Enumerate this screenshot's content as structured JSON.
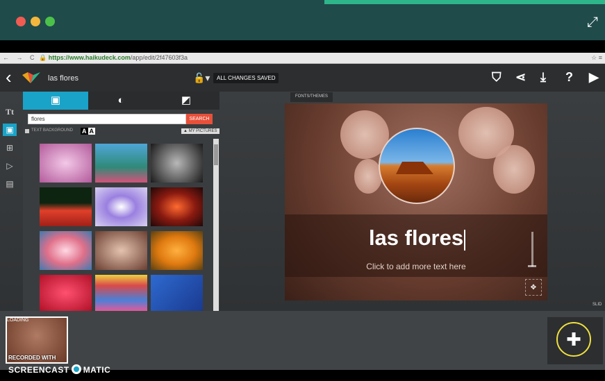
{
  "browser": {
    "url_secure": "https://www.haikudeck.com",
    "url_path": "/app/edit/2f47603f3a",
    "nav_icons": "← → C"
  },
  "app": {
    "deck_name": "las flores",
    "save_status": "ALL CHANGES SAVED",
    "colors": {
      "titlebar": "#1f4b4b",
      "accent": "#1aa3c8",
      "search_button": "#e8503a"
    }
  },
  "image_panel": {
    "search_value": "flores",
    "search_button": "SEARCH",
    "text_background_label": "TEXT BACKGROUND",
    "my_pictures": "▲ MY PICTURES",
    "aa_dark": "A",
    "aa_light": "A"
  },
  "slide": {
    "fonts_tab": "FONTS/THEMES",
    "title": "las flores",
    "subtitle": "Click to add more text here",
    "side_label": "SLID"
  },
  "filmstrip": {
    "loading": "LOADING"
  },
  "watermark": {
    "recorded_with": "RECORDED WITH",
    "brand_left": "SCREENCAST",
    "brand_right": "MATIC"
  }
}
